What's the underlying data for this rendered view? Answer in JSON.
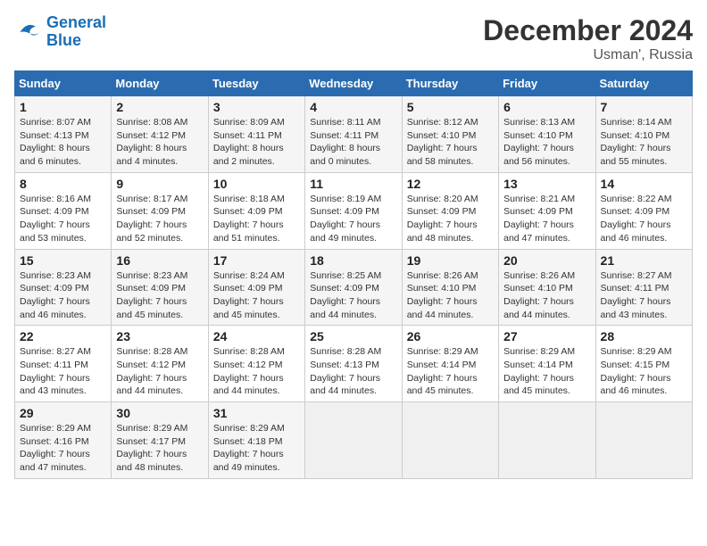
{
  "header": {
    "logo_line1": "General",
    "logo_line2": "Blue",
    "month": "December 2024",
    "location": "Usman', Russia"
  },
  "weekdays": [
    "Sunday",
    "Monday",
    "Tuesday",
    "Wednesday",
    "Thursday",
    "Friday",
    "Saturday"
  ],
  "weeks": [
    [
      {
        "day": "1",
        "sunrise": "8:07 AM",
        "sunset": "4:13 PM",
        "daylight": "8 hours and 6 minutes."
      },
      {
        "day": "2",
        "sunrise": "8:08 AM",
        "sunset": "4:12 PM",
        "daylight": "8 hours and 4 minutes."
      },
      {
        "day": "3",
        "sunrise": "8:09 AM",
        "sunset": "4:11 PM",
        "daylight": "8 hours and 2 minutes."
      },
      {
        "day": "4",
        "sunrise": "8:11 AM",
        "sunset": "4:11 PM",
        "daylight": "8 hours and 0 minutes."
      },
      {
        "day": "5",
        "sunrise": "8:12 AM",
        "sunset": "4:10 PM",
        "daylight": "7 hours and 58 minutes."
      },
      {
        "day": "6",
        "sunrise": "8:13 AM",
        "sunset": "4:10 PM",
        "daylight": "7 hours and 56 minutes."
      },
      {
        "day": "7",
        "sunrise": "8:14 AM",
        "sunset": "4:10 PM",
        "daylight": "7 hours and 55 minutes."
      }
    ],
    [
      {
        "day": "8",
        "sunrise": "8:16 AM",
        "sunset": "4:09 PM",
        "daylight": "7 hours and 53 minutes."
      },
      {
        "day": "9",
        "sunrise": "8:17 AM",
        "sunset": "4:09 PM",
        "daylight": "7 hours and 52 minutes."
      },
      {
        "day": "10",
        "sunrise": "8:18 AM",
        "sunset": "4:09 PM",
        "daylight": "7 hours and 51 minutes."
      },
      {
        "day": "11",
        "sunrise": "8:19 AM",
        "sunset": "4:09 PM",
        "daylight": "7 hours and 49 minutes."
      },
      {
        "day": "12",
        "sunrise": "8:20 AM",
        "sunset": "4:09 PM",
        "daylight": "7 hours and 48 minutes."
      },
      {
        "day": "13",
        "sunrise": "8:21 AM",
        "sunset": "4:09 PM",
        "daylight": "7 hours and 47 minutes."
      },
      {
        "day": "14",
        "sunrise": "8:22 AM",
        "sunset": "4:09 PM",
        "daylight": "7 hours and 46 minutes."
      }
    ],
    [
      {
        "day": "15",
        "sunrise": "8:23 AM",
        "sunset": "4:09 PM",
        "daylight": "7 hours and 46 minutes."
      },
      {
        "day": "16",
        "sunrise": "8:23 AM",
        "sunset": "4:09 PM",
        "daylight": "7 hours and 45 minutes."
      },
      {
        "day": "17",
        "sunrise": "8:24 AM",
        "sunset": "4:09 PM",
        "daylight": "7 hours and 45 minutes."
      },
      {
        "day": "18",
        "sunrise": "8:25 AM",
        "sunset": "4:09 PM",
        "daylight": "7 hours and 44 minutes."
      },
      {
        "day": "19",
        "sunrise": "8:26 AM",
        "sunset": "4:10 PM",
        "daylight": "7 hours and 44 minutes."
      },
      {
        "day": "20",
        "sunrise": "8:26 AM",
        "sunset": "4:10 PM",
        "daylight": "7 hours and 44 minutes."
      },
      {
        "day": "21",
        "sunrise": "8:27 AM",
        "sunset": "4:11 PM",
        "daylight": "7 hours and 43 minutes."
      }
    ],
    [
      {
        "day": "22",
        "sunrise": "8:27 AM",
        "sunset": "4:11 PM",
        "daylight": "7 hours and 43 minutes."
      },
      {
        "day": "23",
        "sunrise": "8:28 AM",
        "sunset": "4:12 PM",
        "daylight": "7 hours and 44 minutes."
      },
      {
        "day": "24",
        "sunrise": "8:28 AM",
        "sunset": "4:12 PM",
        "daylight": "7 hours and 44 minutes."
      },
      {
        "day": "25",
        "sunrise": "8:28 AM",
        "sunset": "4:13 PM",
        "daylight": "7 hours and 44 minutes."
      },
      {
        "day": "26",
        "sunrise": "8:29 AM",
        "sunset": "4:14 PM",
        "daylight": "7 hours and 45 minutes."
      },
      {
        "day": "27",
        "sunrise": "8:29 AM",
        "sunset": "4:14 PM",
        "daylight": "7 hours and 45 minutes."
      },
      {
        "day": "28",
        "sunrise": "8:29 AM",
        "sunset": "4:15 PM",
        "daylight": "7 hours and 46 minutes."
      }
    ],
    [
      {
        "day": "29",
        "sunrise": "8:29 AM",
        "sunset": "4:16 PM",
        "daylight": "7 hours and 47 minutes."
      },
      {
        "day": "30",
        "sunrise": "8:29 AM",
        "sunset": "4:17 PM",
        "daylight": "7 hours and 48 minutes."
      },
      {
        "day": "31",
        "sunrise": "8:29 AM",
        "sunset": "4:18 PM",
        "daylight": "7 hours and 49 minutes."
      },
      null,
      null,
      null,
      null
    ]
  ]
}
